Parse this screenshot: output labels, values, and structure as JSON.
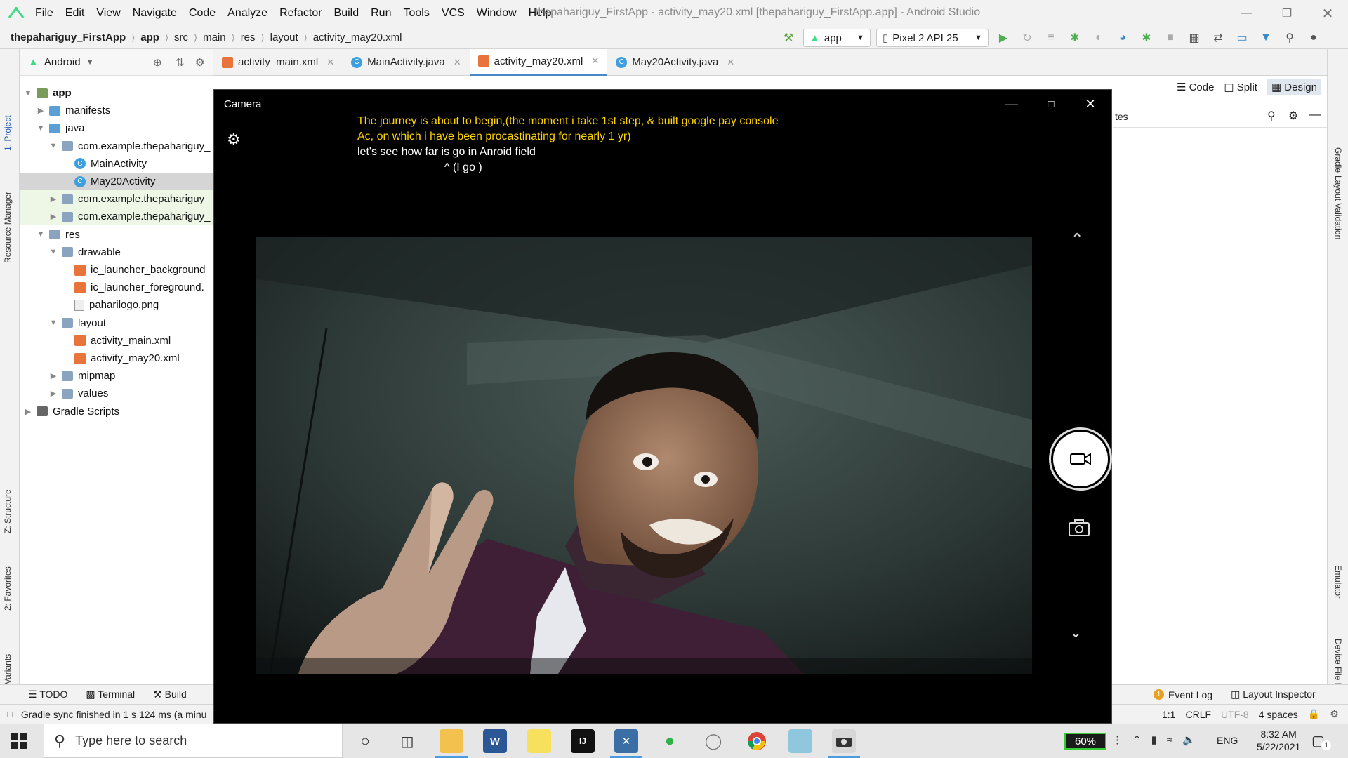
{
  "menubar": {
    "items": [
      "File",
      "Edit",
      "View",
      "Navigate",
      "Code",
      "Analyze",
      "Refactor",
      "Build",
      "Run",
      "Tools",
      "VCS",
      "Window",
      "Help"
    ],
    "window_title": "thepahariguy_FirstApp - activity_may20.xml [thepahariguy_FirstApp.app] - Android Studio"
  },
  "navbar": {
    "breadcrumbs": [
      "thepahariguy_FirstApp",
      "app",
      "src",
      "main",
      "res",
      "layout",
      "activity_may20.xml"
    ],
    "run_config": "app",
    "device": "Pixel 2 API 25"
  },
  "project_panel": {
    "view_mode": "Android",
    "tree": [
      {
        "label": "app",
        "type": "module",
        "level": 0
      },
      {
        "label": "manifests",
        "type": "folder",
        "level": 1
      },
      {
        "label": "java",
        "type": "folder",
        "level": 1
      },
      {
        "label": "com.example.thepahariguy_",
        "type": "package",
        "level": 2
      },
      {
        "label": "MainActivity",
        "type": "class",
        "level": 3
      },
      {
        "label": "May20Activity",
        "type": "class",
        "level": 3
      },
      {
        "label": "com.example.thepahariguy_",
        "type": "package",
        "level": 2
      },
      {
        "label": "com.example.thepahariguy_",
        "type": "package",
        "level": 2
      },
      {
        "label": "res",
        "type": "folder",
        "level": 1
      },
      {
        "label": "drawable",
        "type": "folder",
        "level": 2
      },
      {
        "label": "ic_launcher_background",
        "type": "xml",
        "level": 3
      },
      {
        "label": "ic_launcher_foreground.",
        "type": "xml",
        "level": 3
      },
      {
        "label": "paharilogo.png",
        "type": "png",
        "level": 3
      },
      {
        "label": "layout",
        "type": "folder",
        "level": 2
      },
      {
        "label": "activity_main.xml",
        "type": "xml",
        "level": 3
      },
      {
        "label": "activity_may20.xml",
        "type": "xml",
        "level": 3
      },
      {
        "label": "mipmap",
        "type": "folder",
        "level": 2
      },
      {
        "label": "values",
        "type": "folder",
        "level": 2
      },
      {
        "label": "Gradle Scripts",
        "type": "gradle",
        "level": 0
      }
    ],
    "side_labels": [
      "1: Project",
      "Resource Manager",
      "Z: Structure",
      "2: Favorites",
      "Build Variants"
    ]
  },
  "editor_tabs": [
    "activity_main.xml",
    "MainActivity.java",
    "activity_may20.xml",
    "May20Activity.java"
  ],
  "editor": {
    "view_modes": [
      "Code",
      "Split",
      "Design"
    ],
    "palette_fragment": "tes"
  },
  "right_strip_labels": [
    "Gradle",
    "Layout Validation",
    "Emulator",
    "Device File Explorer"
  ],
  "camera": {
    "title": "Camera",
    "note_lines_yellow": [
      "The journey is about to begin,(the moment i take 1st step, & built google pay console",
      "Ac, on which i have been procastinating for nearly 1 yr)"
    ],
    "note_lines_white": [
      "let's see how far is go in Anroid field",
      "^ (I go )"
    ]
  },
  "bottom_tools": {
    "left": [
      "TODO",
      "Terminal",
      "Build"
    ],
    "right": [
      "Event Log",
      "Layout Inspector"
    ],
    "event_count": "1"
  },
  "statusbar": {
    "message": "Gradle sync finished in 1 s 124 ms (a minu",
    "position": "1:1",
    "line_sep": "CRLF",
    "encoding": "UTF-8",
    "indent": "4 spaces"
  },
  "taskbar": {
    "search_placeholder": "Type here to search",
    "battery": "60%",
    "language": "ENG",
    "time": "8:32 AM",
    "date": "5/22/2021",
    "notif_count": "1"
  }
}
